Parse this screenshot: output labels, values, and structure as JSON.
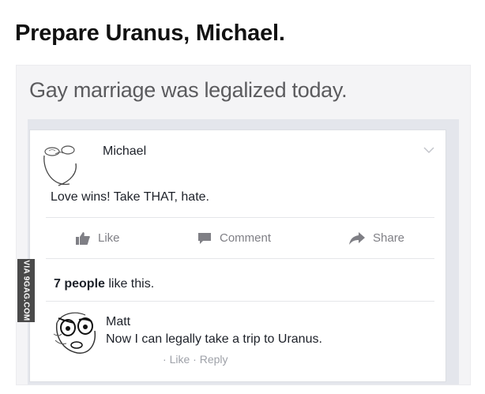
{
  "headline": "Prepare Uranus, Michael.",
  "status": "Gay marriage was legalized today.",
  "post": {
    "author": "Michael",
    "text": "Love wins! Take THAT, hate.",
    "actions": {
      "like": "Like",
      "comment": "Comment",
      "share": "Share"
    },
    "likes": {
      "count": "7 people",
      "suffix": " like this."
    }
  },
  "comment": {
    "author": "Matt",
    "text": "Now I can legally take a trip to Uranus.",
    "like": "Like",
    "separator": " · ",
    "reply": "Reply",
    "prefix": "· "
  },
  "watermark": "VIA 9GAG.COM",
  "icons": {
    "chevron": "chevron-down-icon",
    "like": "thumbs-up-icon",
    "comment": "comment-bubble-icon",
    "share": "share-arrow-icon"
  },
  "colors": {
    "text": "#1d2129",
    "muted": "#7f7f85",
    "status": "#5b5b5e",
    "feed": "#e4e6ec"
  }
}
